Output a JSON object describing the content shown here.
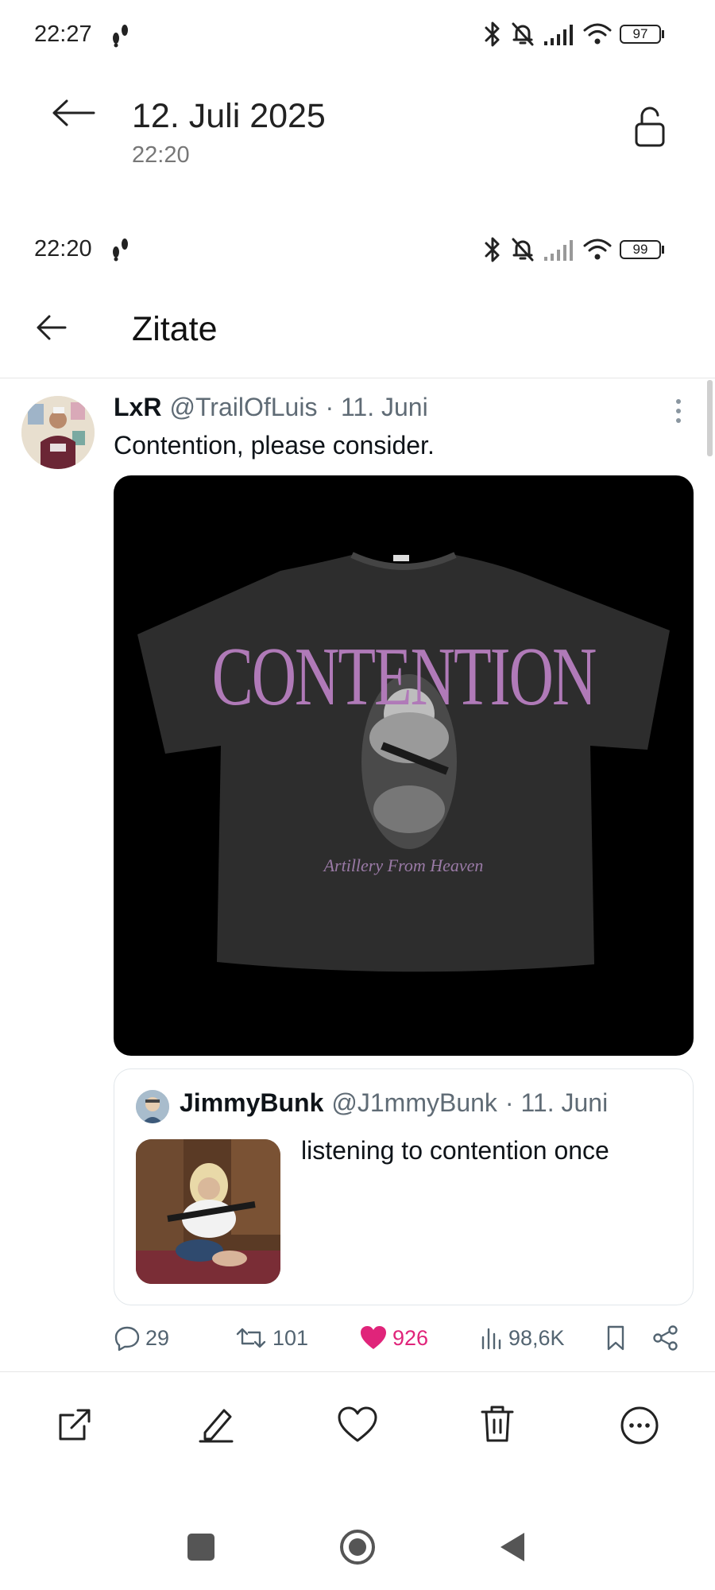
{
  "viewer_status": {
    "time": "22:27",
    "battery": "97"
  },
  "viewer_header": {
    "date": "12. Juli 2025",
    "time": "22:20"
  },
  "shot_status": {
    "time": "22:20",
    "battery": "99"
  },
  "page": {
    "title": "Zitate"
  },
  "tweet": {
    "name": "LxR",
    "handle": "@TrailOfLuis",
    "date": "· 11. Juni",
    "text": "Contention, please consider.",
    "image": {
      "shirt_title": "CONTENTION",
      "shirt_subtitle": "Artillery From Heaven"
    },
    "quoted": {
      "name": "JimmyBunk",
      "handle": "@J1mmyBunk",
      "date": "· 11. Juni",
      "text": "listening to contention once"
    },
    "stats": {
      "replies": "29",
      "retweets": "101",
      "likes": "926",
      "views": "98,6K"
    },
    "like_color": "#e0247a"
  },
  "viewer_toolbar": {
    "icons": [
      "share-external-icon",
      "edit-icon",
      "heart-icon",
      "trash-icon",
      "more-icon"
    ]
  },
  "nav": {
    "icons": [
      "recents-icon",
      "home-icon",
      "back-icon"
    ]
  }
}
